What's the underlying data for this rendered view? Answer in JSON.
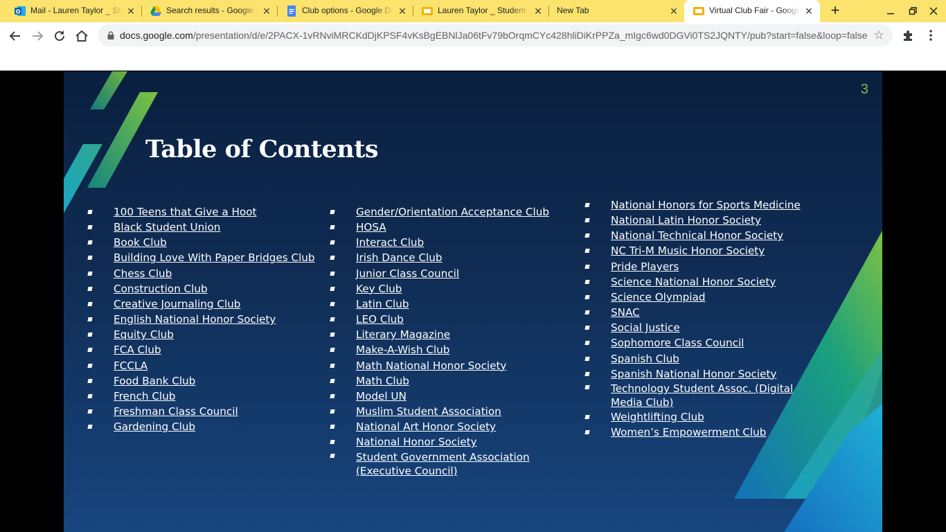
{
  "browser": {
    "tabs": [
      {
        "title": "Mail - Lauren Taylor _ Student",
        "icon": "outlook-icon"
      },
      {
        "title": "Search results - Google Drive",
        "icon": "google-drive-icon"
      },
      {
        "title": "Club options - Google Docs",
        "icon": "google-docs-icon"
      },
      {
        "title": "Lauren Taylor _ Student",
        "icon": "google-slides-icon"
      },
      {
        "title": "New Tab",
        "icon": ""
      },
      {
        "title": "Virtual Club Fair - Google Slides",
        "icon": "google-slides-icon",
        "active": true
      }
    ],
    "url_host": "docs.google.com",
    "url_path": "/presentation/d/e/2PACX-1vRNviMRCKdDjKPSF4vKsBgEBNlJa06tFv79bOrqmCYc428hliDiKrPPZa_mIgc6wd0DGVi0TS2JQNTY/pub?start=false&loop=false",
    "colors": {
      "tab_strip": "#fbe36d",
      "toolbar": "#ffffff",
      "omnibox": "#f1f3f4"
    }
  },
  "slide": {
    "number": "3",
    "title": "Table of Contents",
    "colors": {
      "title": "#ffffff",
      "number": "#7cc242",
      "accent_green": "#7cc242",
      "accent_teal": "#19b5c9"
    },
    "columns": [
      [
        "100 Teens that Give a Hoot",
        "Black Student Union",
        "Book Club",
        "Building Love With Paper Bridges Club",
        "Chess Club",
        "Construction Club",
        "Creative Journaling Club",
        "English National Honor Society",
        "Equity Club",
        "FCA Club",
        "FCCLA",
        "Food Bank Club",
        "French Club",
        "Freshman Class Council",
        "Gardening Club"
      ],
      [
        "Gender/Orientation Acceptance  Club",
        "HOSA",
        "Interact Club",
        "Irish Dance Club",
        "Junior Class Council",
        "Key Club",
        "Latin Club",
        "LEO Club",
        "Literary Magazine",
        "Make-A-Wish Club",
        "Math National Honor Society",
        "Math Club",
        "Model UN",
        "Muslim Student Association",
        "National Art Honor Society",
        "National Honor Society",
        "Student Government Association (Executive Council)"
      ],
      [
        "National Honors for Sports Medicine",
        "National Latin Honor Society",
        "National Technical Honor Society",
        "NC Tri-M Music Honor Society",
        "Pride Players",
        "Science National Honor Society",
        "Science Olympiad",
        "SNAC",
        "Social Justice",
        "Sophomore Class Council",
        "Spanish Club",
        "Spanish National Honor Society",
        "Technology Student Assoc. (Digital Media Club)",
        "Weightlifting Club",
        "Women’s Empowerment Club"
      ]
    ]
  }
}
